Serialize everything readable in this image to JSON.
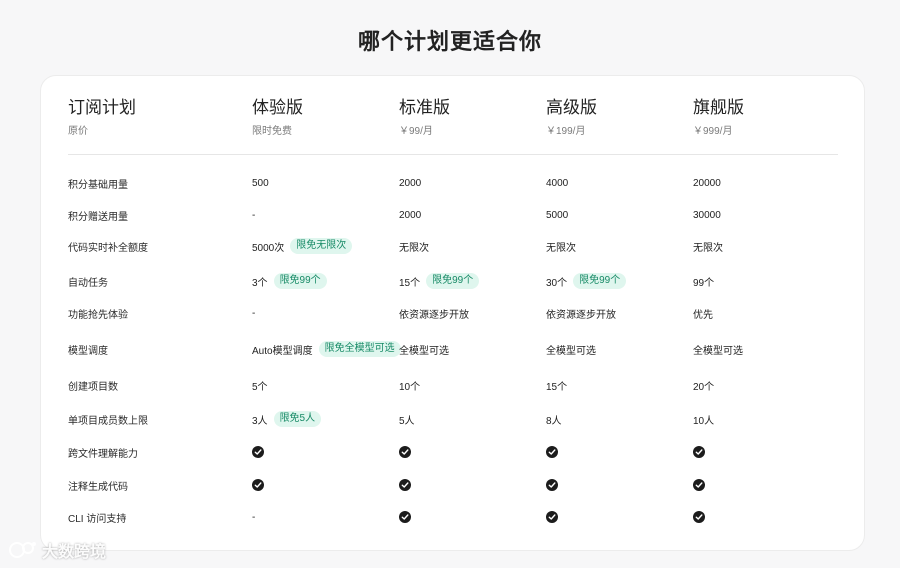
{
  "page": {
    "title": "哪个计划更适合你"
  },
  "plans": [
    {
      "name": "订阅计划",
      "price": "原价"
    },
    {
      "name": "体验版",
      "price": "限时免费"
    },
    {
      "name": "标准版",
      "price": "￥99/月"
    },
    {
      "name": "高级版",
      "price": "￥199/月"
    },
    {
      "name": "旗舰版",
      "price": "￥999/月"
    }
  ],
  "rows": [
    {
      "feature": "积分基础用量",
      "values": [
        {
          "text": "500"
        },
        {
          "text": "2000"
        },
        {
          "text": "4000"
        },
        {
          "text": "20000"
        }
      ]
    },
    {
      "feature": "积分赠送用量",
      "values": [
        {
          "text": "-"
        },
        {
          "text": "2000"
        },
        {
          "text": "5000"
        },
        {
          "text": "30000"
        }
      ]
    },
    {
      "feature": "代码实时补全额度",
      "values": [
        {
          "text": "5000次",
          "badge": "限免无限次"
        },
        {
          "text": "无限次"
        },
        {
          "text": "无限次"
        },
        {
          "text": "无限次"
        }
      ]
    },
    {
      "feature": "自动任务",
      "values": [
        {
          "text": "3个",
          "badge": "限免99个"
        },
        {
          "text": "15个",
          "badge": "限免99个"
        },
        {
          "text": "30个",
          "badge": "限免99个"
        },
        {
          "text": "99个"
        }
      ]
    },
    {
      "feature": "功能抢先体验",
      "values": [
        {
          "text": "-"
        },
        {
          "text": "依资源逐步开放"
        },
        {
          "text": "依资源逐步开放"
        },
        {
          "text": "优先"
        }
      ]
    },
    {
      "feature": "模型调度",
      "values": [
        {
          "text": "Auto模型调度",
          "badge": "限免全模型可选"
        },
        {
          "text": "全模型可选"
        },
        {
          "text": "全模型可选"
        },
        {
          "text": "全模型可选"
        }
      ]
    },
    {
      "feature": "创建项目数",
      "values": [
        {
          "text": "5个"
        },
        {
          "text": "10个"
        },
        {
          "text": "15个"
        },
        {
          "text": "20个"
        }
      ]
    },
    {
      "feature": "单项目成员数上限",
      "values": [
        {
          "text": "3人",
          "badge": "限免5人"
        },
        {
          "text": "5人"
        },
        {
          "text": "8人"
        },
        {
          "text": "10人"
        }
      ]
    },
    {
      "feature": "跨文件理解能力",
      "values": [
        {
          "check": true
        },
        {
          "check": true
        },
        {
          "check": true
        },
        {
          "check": true
        }
      ]
    },
    {
      "feature": "注释生成代码",
      "values": [
        {
          "check": true
        },
        {
          "check": true
        },
        {
          "check": true
        },
        {
          "check": true
        }
      ]
    },
    {
      "feature": "CLI 访问支持",
      "values": [
        {
          "text": "-"
        },
        {
          "check": true
        },
        {
          "check": true
        },
        {
          "check": true
        }
      ]
    }
  ],
  "watermark": {
    "text": "大数跨境"
  },
  "colors": {
    "badge_bg": "#dff6ee",
    "badge_text": "#178a66",
    "check": "#1c1c1c"
  }
}
